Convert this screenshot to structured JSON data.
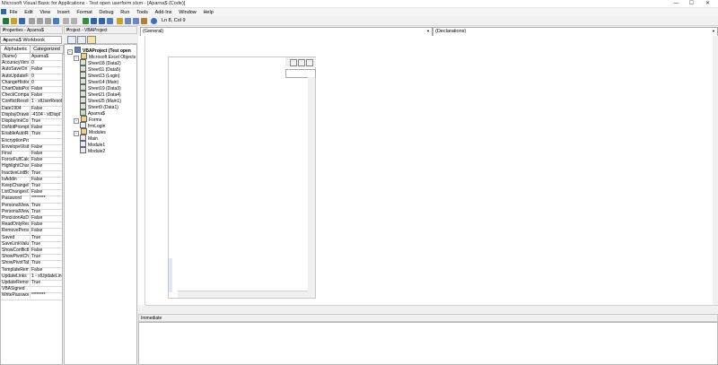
{
  "window": {
    "title": "Microsoft Visual Basic for Applications - Test open userform.xlsm - [Aparna$ (Code)]",
    "controls": [
      "—",
      "☐",
      "✕"
    ]
  },
  "menu": [
    "File",
    "Edit",
    "View",
    "Insert",
    "Format",
    "Debug",
    "Run",
    "Tools",
    "Add-Ins",
    "Window",
    "Help"
  ],
  "toolbar": {
    "position": "Ln 8, Col 9"
  },
  "properties": {
    "title": "Properties - Aparna$",
    "object": "Aparna$ Workbook",
    "tabs": [
      "Alphabetic",
      "Categorized"
    ],
    "rows": [
      {
        "name": "(Name)",
        "value": "Aparna$"
      },
      {
        "name": "AccuracyVersion",
        "value": "0"
      },
      {
        "name": "AutoSaveOn",
        "value": "False"
      },
      {
        "name": "AutoUpdateFreq",
        "value": "0"
      },
      {
        "name": "ChangeHistoryDu",
        "value": "0"
      },
      {
        "name": "ChartDataPointTr",
        "value": "False"
      },
      {
        "name": "CheckCompatibility",
        "value": "False"
      },
      {
        "name": "ConflictResolution",
        "value": "1 - xlUserResol"
      },
      {
        "name": "Date1904",
        "value": "False"
      },
      {
        "name": "DisplayDrawingO",
        "value": "-4104 - xlDispl"
      },
      {
        "name": "DisplayInkComm",
        "value": "True"
      },
      {
        "name": "DoNotPromptFor",
        "value": "False"
      },
      {
        "name": "EnableAutoRecov",
        "value": "True"
      },
      {
        "name": "EncryptionProvi",
        "value": ""
      },
      {
        "name": "EnvelopeVisible",
        "value": "False"
      },
      {
        "name": "Final",
        "value": "False"
      },
      {
        "name": "ForceFullCalculat",
        "value": "False"
      },
      {
        "name": "HighlightChange",
        "value": "False"
      },
      {
        "name": "InactiveListBord",
        "value": "True"
      },
      {
        "name": "IsAddin",
        "value": "False"
      },
      {
        "name": "KeepChangeHist",
        "value": "True"
      },
      {
        "name": "ListChangesOnN",
        "value": "False"
      },
      {
        "name": "Password",
        "value": "********"
      },
      {
        "name": "PersonalViewList",
        "value": "True"
      },
      {
        "name": "PersonalViewPrin",
        "value": "True"
      },
      {
        "name": "PrecisionAsDispl",
        "value": "False"
      },
      {
        "name": "ReadOnlyRecomm",
        "value": "False"
      },
      {
        "name": "RemovePersonal",
        "value": "False"
      },
      {
        "name": "Saved",
        "value": "True"
      },
      {
        "name": "SaveLinkValues",
        "value": "True"
      },
      {
        "name": "ShowConflictHist",
        "value": "False"
      },
      {
        "name": "ShowPivotChart",
        "value": "True"
      },
      {
        "name": "ShowPivotTable",
        "value": "True"
      },
      {
        "name": "TemplateRemove",
        "value": "False"
      },
      {
        "name": "UpdateLinks",
        "value": "1 - xlUpdateLin"
      },
      {
        "name": "UpdateRemoteRef",
        "value": "True"
      },
      {
        "name": "VBASigned",
        "value": ""
      },
      {
        "name": "WritePassword",
        "value": "********"
      }
    ]
  },
  "project": {
    "title": "Project - VBAProject",
    "tree": [
      {
        "label": "VBAProject (Test open",
        "level": 0,
        "toggle": "−",
        "icon": "project-icon"
      },
      {
        "label": "Microsoft Excel Objects",
        "level": 1,
        "toggle": "−",
        "icon": "folder-icon"
      },
      {
        "label": "Sheet18 (Data2)",
        "level": 2,
        "icon": "sheet-icon"
      },
      {
        "label": "Sheet11 (Data5)",
        "level": 2,
        "icon": "sheet-icon"
      },
      {
        "label": "Sheet13 (Login)",
        "level": 2,
        "icon": "sheet-icon"
      },
      {
        "label": "Sheet14 (Main)",
        "level": 2,
        "icon": "sheet-icon"
      },
      {
        "label": "Sheet19 (Data3)",
        "level": 2,
        "icon": "sheet-icon"
      },
      {
        "label": "Sheet21 (Data4)",
        "level": 2,
        "icon": "sheet-icon"
      },
      {
        "label": "Sheet25 (Main1)",
        "level": 2,
        "icon": "sheet-icon"
      },
      {
        "label": "Sheet9 (Data1)",
        "level": 2,
        "icon": "sheet-icon"
      },
      {
        "label": "Aparna$",
        "level": 2,
        "icon": "workbook-icon"
      },
      {
        "label": "Forms",
        "level": 1,
        "toggle": "−",
        "icon": "folder-icon"
      },
      {
        "label": "frmLogin",
        "level": 2,
        "icon": "form-icon"
      },
      {
        "label": "Modules",
        "level": 1,
        "toggle": "−",
        "icon": "folder-icon"
      },
      {
        "label": "Main",
        "level": 2,
        "icon": "module-icon"
      },
      {
        "label": "Module1",
        "level": 2,
        "icon": "module-icon"
      },
      {
        "label": "Module2",
        "level": 2,
        "icon": "module-icon"
      }
    ]
  },
  "code": {
    "object_combo": "(General)",
    "proc_combo": "(Declarations)"
  },
  "immediate": {
    "title": "Immediate"
  }
}
